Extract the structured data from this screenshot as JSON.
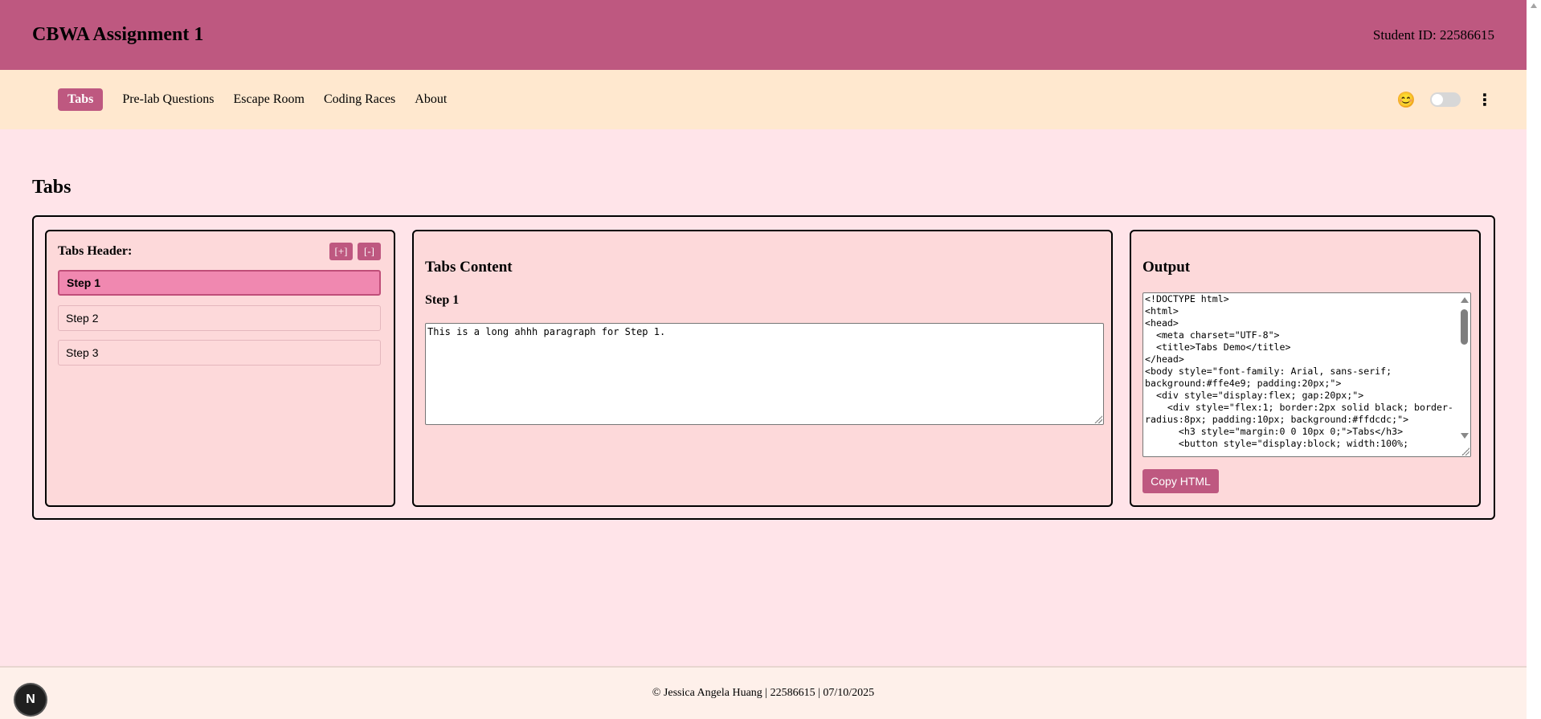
{
  "header": {
    "title": "CBWA Assignment 1",
    "student_id": "Student ID: 22586615"
  },
  "nav": {
    "items": [
      {
        "label": "Tabs",
        "active": true
      },
      {
        "label": "Pre-lab Questions"
      },
      {
        "label": "Escape Room"
      },
      {
        "label": "Coding Races"
      },
      {
        "label": "About"
      }
    ],
    "emoji": "😊"
  },
  "page": {
    "title": "Tabs"
  },
  "tabs_header": {
    "label": "Tabs Header:",
    "add_label": "[+]",
    "remove_label": "[-]",
    "items": [
      {
        "label": "Step 1",
        "active": true
      },
      {
        "label": "Step 2"
      },
      {
        "label": "Step 3"
      }
    ]
  },
  "tabs_content": {
    "title": "Tabs Content",
    "step_title": "Step 1",
    "text": "This is a long ahhh paragraph for Step 1."
  },
  "output": {
    "title": "Output",
    "code": "<!DOCTYPE html>\n<html>\n<head>\n  <meta charset=\"UTF-8\">\n  <title>Tabs Demo</title>\n</head>\n<body style=\"font-family: Arial, sans-serif; background:#ffe4e9; padding:20px;\">\n  <div style=\"display:flex; gap:20px;\">\n    <div style=\"flex:1; border:2px solid black; border-radius:8px; padding:10px; background:#ffdcdc;\">\n      <h3 style=\"margin:0 0 10px 0;\">Tabs</h3>\n      <button style=\"display:block; width:100%;",
    "copy_label": "Copy HTML"
  },
  "footer": {
    "text": "© Jessica Angela Huang | 22586615 | 07/10/2025"
  },
  "dev_badge": "N",
  "colors": {
    "accent": "#be5880",
    "nav_bg": "#ffe8cf",
    "page_bg": "#ffe4e9",
    "panel_bg": "#fdd9da",
    "active_tab": "#f088b0"
  }
}
